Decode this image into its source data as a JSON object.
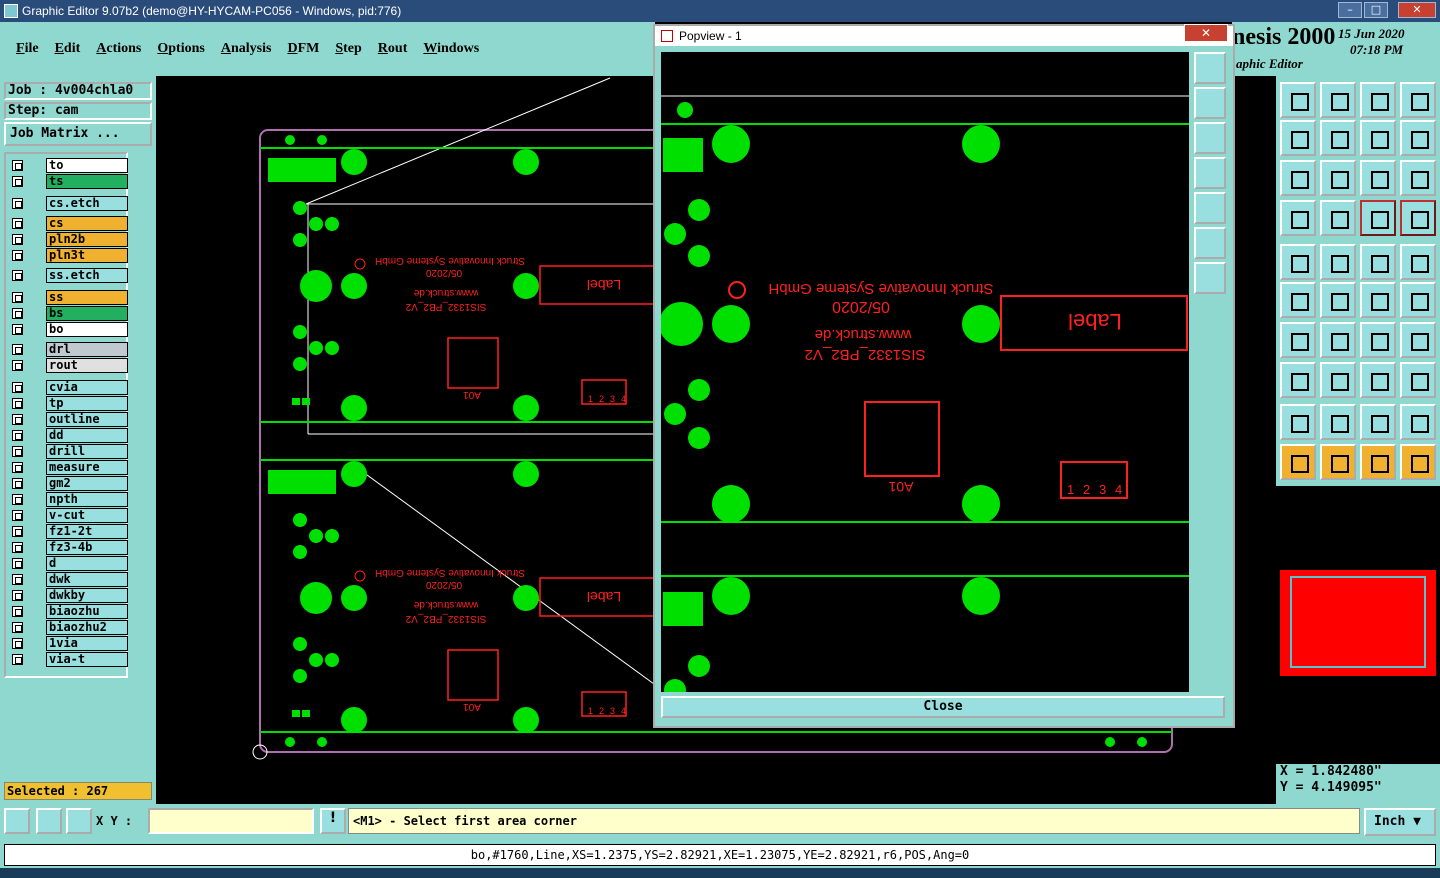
{
  "window": {
    "title": "Graphic Editor 9.07b2 (demo@HY-HYCAM-PC056 - Windows, pid:776)"
  },
  "menu": [
    "File",
    "Edit",
    "Actions",
    "Options",
    "Analysis",
    "DFM",
    "Step",
    "Rout",
    "Windows"
  ],
  "brand": {
    "name": "nesis 2000",
    "sub": "aphic Editor",
    "date": "15 Jun 2020",
    "time": "07:18 PM"
  },
  "job": {
    "job": "Job : 4v004chla0",
    "step": "Step: cam",
    "matrix": "Job Matrix ..."
  },
  "layers": [
    {
      "name": "to",
      "color": "#ffffff"
    },
    {
      "name": "ts",
      "color": "#22b060"
    },
    {
      "name": "cs.etch",
      "color": "#9adfe0"
    },
    {
      "name": "cs",
      "color": "#f0b030"
    },
    {
      "name": "pln2b",
      "color": "#f0b030"
    },
    {
      "name": "pln3t",
      "color": "#f0b030"
    },
    {
      "name": "ss.etch",
      "color": "#9adfe0"
    },
    {
      "name": "ss",
      "color": "#f0b030"
    },
    {
      "name": "bs",
      "color": "#22b060"
    },
    {
      "name": "bo",
      "color": "#ffffff"
    },
    {
      "name": "drl",
      "color": "#c0c8d0"
    },
    {
      "name": "rout",
      "color": "#e0e0e0"
    },
    {
      "name": "cvia",
      "color": "#9adfe0"
    },
    {
      "name": "tp",
      "color": "#9adfe0"
    },
    {
      "name": "outline",
      "color": "#9adfe0"
    },
    {
      "name": "dd",
      "color": "#9adfe0"
    },
    {
      "name": "drill",
      "color": "#9adfe0"
    },
    {
      "name": "measure",
      "color": "#9adfe0"
    },
    {
      "name": "gm2",
      "color": "#9adfe0"
    },
    {
      "name": "npth",
      "color": "#9adfe0"
    },
    {
      "name": "v-cut",
      "color": "#9adfe0"
    },
    {
      "name": "fz1-2t",
      "color": "#9adfe0"
    },
    {
      "name": "fz3-4b",
      "color": "#9adfe0"
    },
    {
      "name": "d",
      "color": "#9adfe0"
    },
    {
      "name": "dwk",
      "color": "#9adfe0"
    },
    {
      "name": "dwkby",
      "color": "#9adfe0"
    },
    {
      "name": "biaozhu",
      "color": "#9adfe0"
    },
    {
      "name": "biaozhu2",
      "color": "#9adfe0"
    },
    {
      "name": "1via",
      "color": "#9adfe0"
    },
    {
      "name": "via-t",
      "color": "#9adfe0"
    }
  ],
  "selected": "Selected : 267",
  "xy_label": "X Y :",
  "prompt": "<M1> - Select first area corner",
  "unit": "Inch",
  "status": "bo,#1760,Line,XS=1.2375,YS=2.82921,XE=1.23075,YE=2.82921,r6,POS,Ang=0",
  "coords": {
    "x": "X = 1.842480\"",
    "y": "Y = 4.149095\""
  },
  "popup": {
    "title": "Popview - 1",
    "close": "Close"
  },
  "board": {
    "silk_company": "Struck Innovative Systeme GmbH",
    "silk_date": "05/2020",
    "silk_url": "www.struck.de",
    "silk_part": "SIS1332_PB2_V2",
    "label": "Label",
    "ic": "A01",
    "pins": [
      "1",
      "2",
      "3",
      "4"
    ]
  },
  "colors": {
    "pad": "#00e000",
    "silk": "#ff2020",
    "bg": "#000000",
    "panel": "#8fd8d0"
  }
}
